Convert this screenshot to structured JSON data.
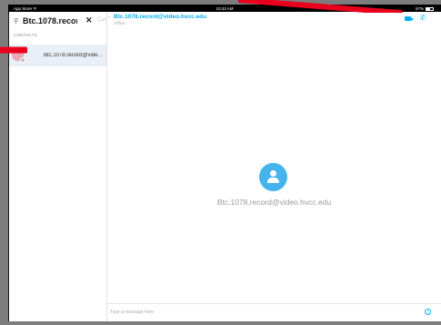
{
  "statusbar": {
    "left": "App Store",
    "time": "10:43 AM",
    "battery": "57%"
  },
  "sidebar": {
    "search_value": "Btc.1078.record...",
    "cancel_label": "Cancel",
    "section_label": "CONTACTS",
    "contact_name": "Btc.1078.record@video.h..."
  },
  "chat": {
    "title": "Btc.1078.record@video.hvcc.edu",
    "status": "Offline",
    "center_name": "Btc.1078.record@video.hvcc.edu",
    "composer_placeholder": "Type a message here"
  },
  "colors": {
    "accent": "#00aff0",
    "annotation": "#e8001c"
  },
  "icons": [
    "search-icon",
    "clear-icon",
    "back-icon",
    "video-call-icon",
    "phone-call-icon",
    "person-icon",
    "info-icon",
    "wifi-icon",
    "battery-icon"
  ]
}
